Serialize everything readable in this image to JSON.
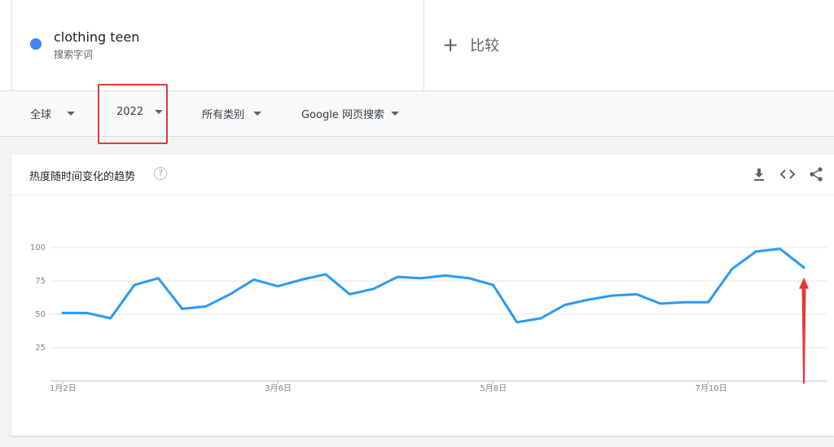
{
  "search_term": {
    "name": "clothing teen",
    "type": "搜索字词",
    "color": "#4285f4"
  },
  "compare": {
    "label": "比较"
  },
  "filters": {
    "region": "全球",
    "time": "2022",
    "category": "所有类别",
    "search_type": "Google 网页搜索"
  },
  "chart_section": {
    "title": "热度随时间变化的趋势",
    "help_glyph": "?",
    "tools": [
      "download-icon",
      "embed-icon",
      "share-icon"
    ]
  },
  "chart_data": {
    "type": "line",
    "title": "",
    "xlabel": "",
    "ylabel": "",
    "ylim": [
      0,
      100
    ],
    "yticks": [
      25,
      50,
      75,
      100
    ],
    "x_tick_labels": [
      {
        "index": 0,
        "label": "1月2日"
      },
      {
        "index": 9,
        "label": "3月6日"
      },
      {
        "index": 18,
        "label": "5月8日"
      },
      {
        "index": 27,
        "label": "7月10日"
      }
    ],
    "grid": true,
    "series": [
      {
        "color": "#2b9af3",
        "values": [
          51,
          51,
          47,
          72,
          77,
          54,
          56,
          65,
          76,
          71,
          76,
          80,
          65,
          69,
          78,
          77,
          79,
          77,
          72,
          44,
          47,
          57,
          61,
          64,
          65,
          58,
          59,
          59,
          84,
          97,
          99,
          85
        ]
      }
    ],
    "annotation_color": "#e53935"
  }
}
